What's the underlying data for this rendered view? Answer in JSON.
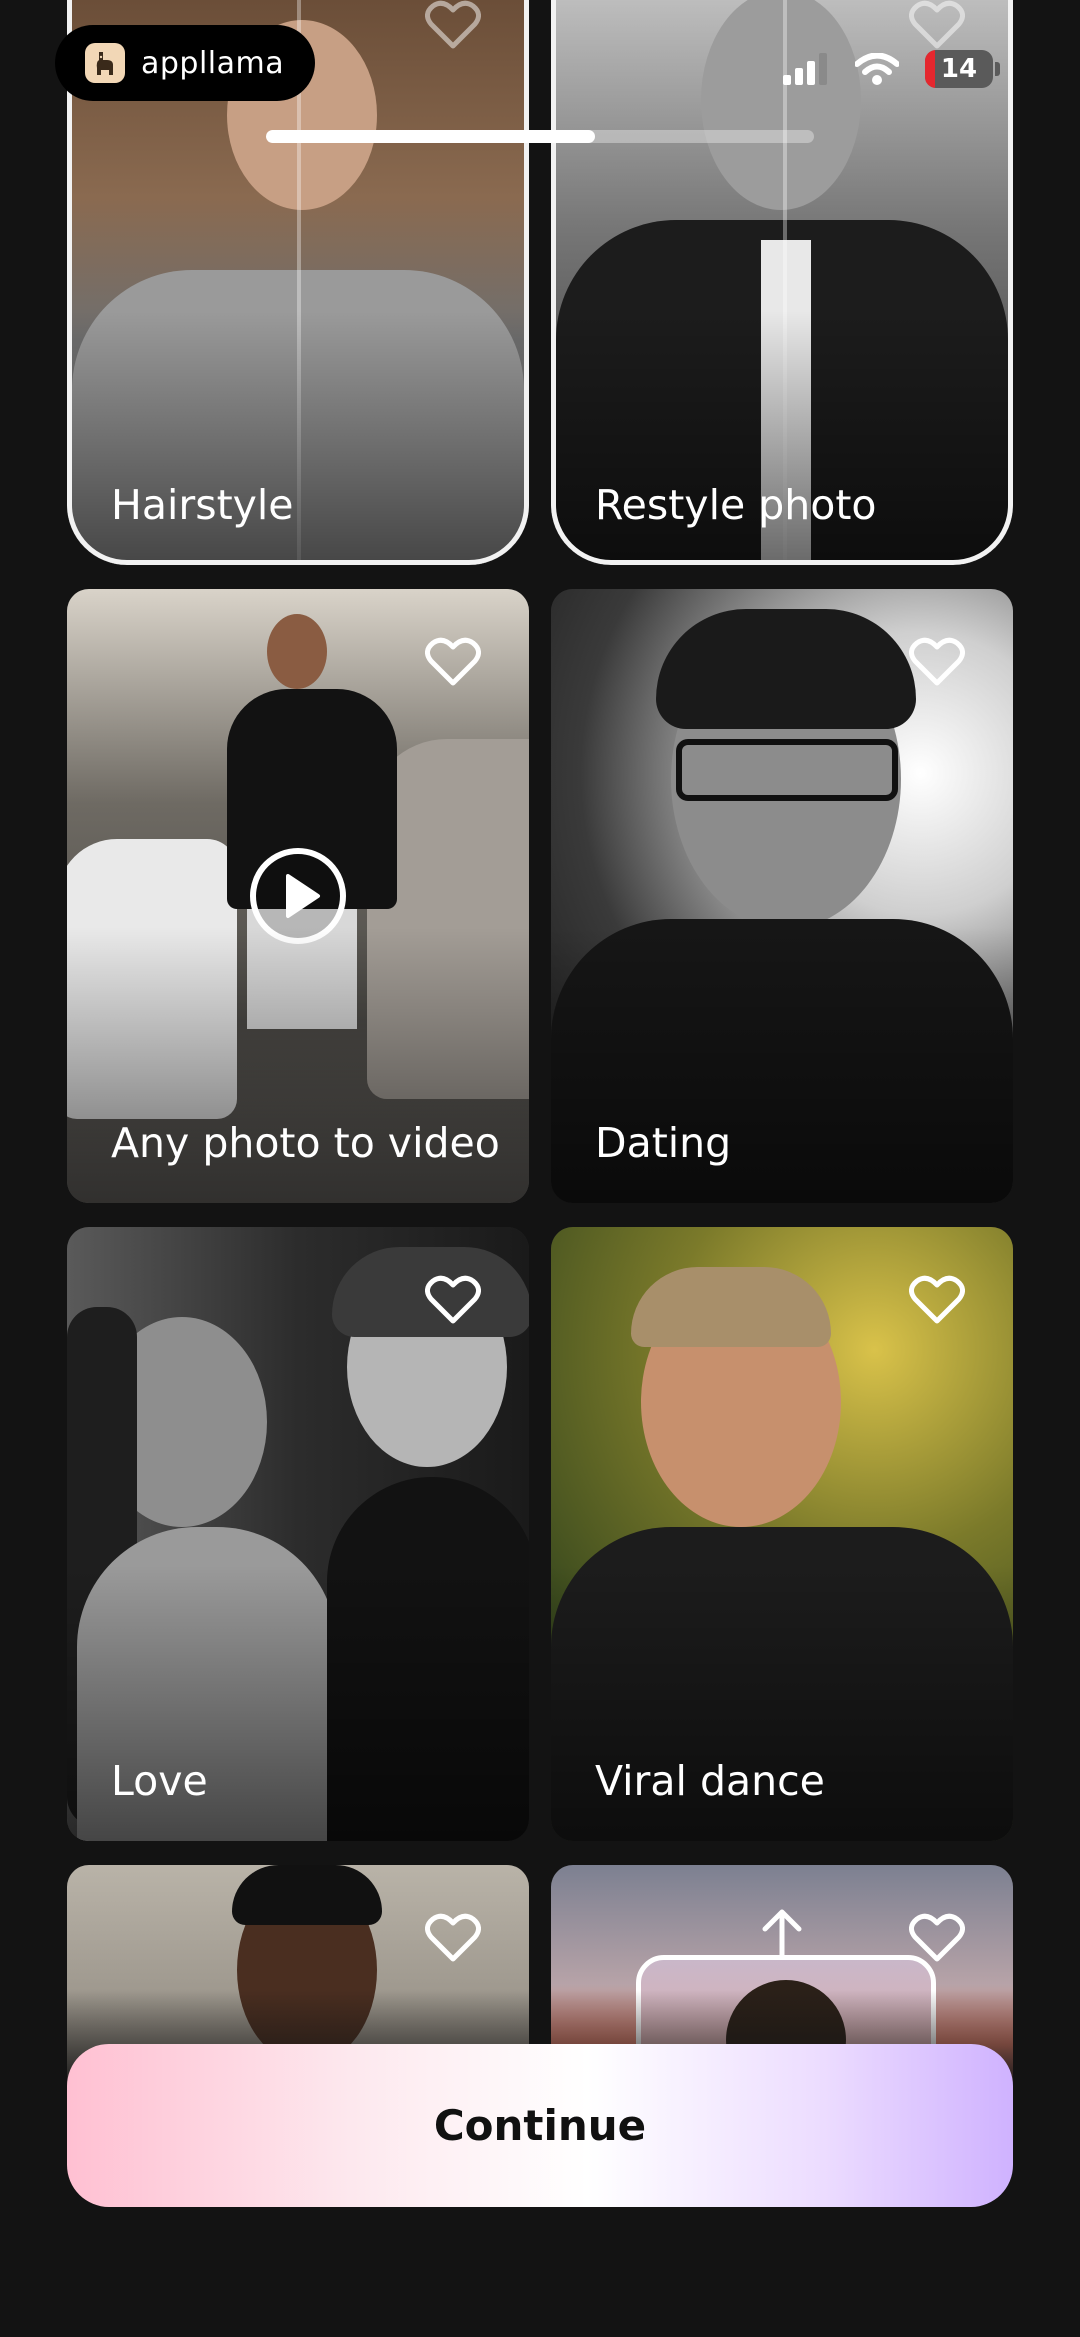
{
  "status_bar": {
    "app_name": "appllama",
    "battery_level": "14"
  },
  "progress": {
    "fraction": 0.6
  },
  "cards": [
    {
      "label": "Hairstyle",
      "selected": true
    },
    {
      "label": "Restyle photo",
      "selected": true
    },
    {
      "label": "Any photo to video",
      "has_play": true
    },
    {
      "label": "Dating"
    },
    {
      "label": "Love"
    },
    {
      "label": "Viral dance"
    },
    {
      "label": ""
    },
    {
      "label": ""
    }
  ],
  "continue_label": "Continue",
  "icons": {
    "fav": "heart-outline-icon",
    "play": "play-circle-icon",
    "upload": "arrow-up-icon",
    "signal": "cellular-signal-icon",
    "wifi": "wifi-icon",
    "battery": "battery-icon"
  },
  "colors": {
    "background": "#131313",
    "selection_outline": "#f2f2f2",
    "battery_low": "#e5272e",
    "button_gradient_start": "#ffc0d2",
    "button_gradient_end": "#cfb2ff"
  }
}
